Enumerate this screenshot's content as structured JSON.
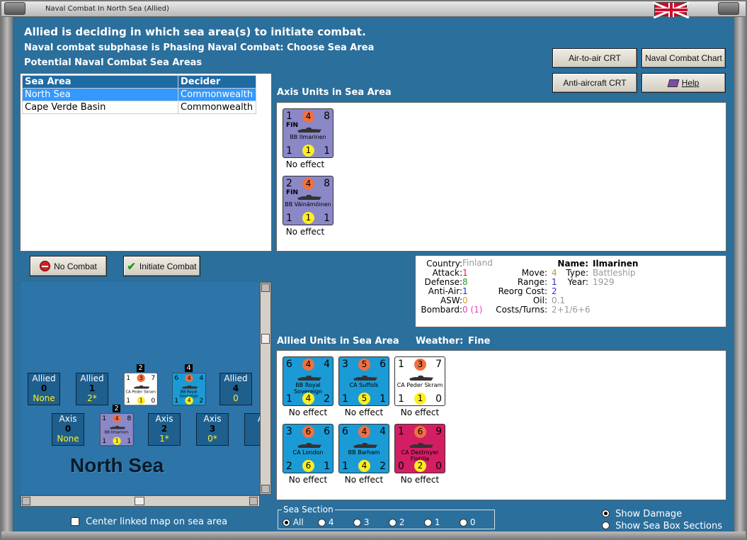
{
  "window": {
    "title": "Naval Combat In North Sea (Allied)"
  },
  "header": {
    "line1": "Allied is deciding in which sea area(s) to initiate combat.",
    "line2": "Naval combat subphase is Phasing Naval Combat: Choose Sea Area",
    "line3": "Potential Naval Combat Sea Areas"
  },
  "buttons": {
    "air_to_air": "Air-to-air CRT",
    "naval_chart": "Naval Combat Chart",
    "anti_aircraft": "Anti-aircraft CRT",
    "help": "Help",
    "no_combat": "No Combat",
    "initiate_combat": "Initiate Combat"
  },
  "sea_table": {
    "headers": [
      "Sea Area",
      "Decider"
    ],
    "rows": [
      {
        "area": "North Sea",
        "decider": "Commonwealth"
      },
      {
        "area": "Cape Verde Basin",
        "decider": "Commonwealth"
      }
    ]
  },
  "axis_section": {
    "title": "Axis Units in Sea Area",
    "units": [
      {
        "tl": "1",
        "atk": "4",
        "tr": "8",
        "nat": "FIN",
        "name": "BB Ilmarinen",
        "bl": "1",
        "def": "1",
        "br": "1",
        "effect": "No effect"
      },
      {
        "tl": "2",
        "atk": "4",
        "tr": "8",
        "nat": "FIN",
        "name": "BB Väinämöinen",
        "bl": "1",
        "def": "1",
        "br": "1",
        "effect": "No effect"
      }
    ]
  },
  "details": {
    "country_label": "Country:",
    "country": "Finland",
    "attack_label": "Attack:",
    "attack": "1",
    "defense_label": "Defense:",
    "defense": "8",
    "antiair_label": "Anti-Air:",
    "antiair": "1",
    "asw_label": "ASW:",
    "asw": "0",
    "bombard_label": "Bombard:",
    "bombard": "0 (1)",
    "name_label": "Name:",
    "name": "Ilmarinen",
    "move_label": "Move:",
    "move": "4",
    "type_label": "Type:",
    "type": "Battleship",
    "range_label": "Range:",
    "range": "1",
    "year_label": "Year:",
    "year": "1929",
    "reorg_label": "Reorg Cost:",
    "reorg": "2",
    "oil_label": "Oil:",
    "oil": "0.1",
    "costs_label": "Costs/Turns:",
    "costs": "2+1/6+6"
  },
  "allied_section": {
    "title": "Allied Units in Sea Area",
    "weather_label": "Weather:",
    "weather": "Fine",
    "units": [
      {
        "tl": "6",
        "atk": "4",
        "tr": "4",
        "name": "BB Royal Sovereign",
        "bl": "1",
        "def": "4",
        "br": "2",
        "effect": "No effect",
        "color": "#1a9bd6"
      },
      {
        "tl": "3",
        "atk": "5",
        "tr": "6",
        "name": "CA Suffolk",
        "bl": "1",
        "def": "5",
        "br": "1",
        "effect": "No effect",
        "color": "#1a9bd6"
      },
      {
        "tl": "1",
        "atk": "3",
        "tr": "7",
        "name": "CA Peder Skram",
        "bl": "1",
        "def": "1",
        "br": "0",
        "effect": "No effect",
        "color": "#ffffff"
      },
      {
        "tl": "3",
        "atk": "6",
        "tr": "6",
        "name": "CA London",
        "bl": "2",
        "def": "6",
        "br": "1",
        "effect": "No effect",
        "color": "#1a9bd6"
      },
      {
        "tl": "6",
        "atk": "4",
        "tr": "4",
        "name": "BB Barham",
        "bl": "1",
        "def": "4",
        "br": "2",
        "effect": "No effect",
        "color": "#1a9bd6"
      },
      {
        "tl": "1",
        "atk": "6",
        "tr": "9",
        "name": "CA Destroyer Flotilla",
        "bl": "0",
        "def": "2",
        "br": "0",
        "effect": "No effect",
        "color": "#d41e63"
      }
    ]
  },
  "map": {
    "sea_name": "North Sea",
    "allied_boxes": [
      {
        "label": "Allied",
        "num": "0",
        "sub": "None"
      },
      {
        "label": "Allied",
        "num": "1",
        "sub": "2*"
      },
      {
        "label": "Allied",
        "num": "4",
        "sub": "0"
      }
    ],
    "axis_boxes": [
      {
        "label": "Axis",
        "num": "0",
        "sub": "None"
      },
      {
        "label": "Axis",
        "num": "2",
        "sub": "1*"
      },
      {
        "label": "Axis",
        "num": "3",
        "sub": "0*"
      },
      {
        "label": "A",
        "num": "",
        "sub": ""
      }
    ],
    "stack_counts": [
      "2",
      "4",
      "2"
    ],
    "mini_units": [
      {
        "tl": "1",
        "atk": "3",
        "tr": "7",
        "name": "CA Peder Skram",
        "bl": "1",
        "def": "1",
        "br": "0"
      },
      {
        "tl": "6",
        "atk": "4",
        "tr": "4",
        "name": "BB Royal Sovereign",
        "bl": "1",
        "def": "4",
        "br": "2"
      },
      {
        "tl": "1",
        "atk": "4",
        "tr": "8",
        "name": "BB Ilmarinen",
        "bl": "1",
        "def": "1",
        "br": "1"
      }
    ],
    "center_checkbox": "Center linked map on sea area"
  },
  "sea_section": {
    "legend": "Sea Section",
    "options": [
      "All",
      "4",
      "3",
      "2",
      "1",
      "0"
    ]
  },
  "display_options": [
    "Show Damage",
    "Show Sea Box Sections"
  ],
  "colors": {
    "atk_circle": "#f07040",
    "def_circle": "#ffee22",
    "axis_unit": "#8b88c8",
    "accent": "#1e6aa3"
  }
}
